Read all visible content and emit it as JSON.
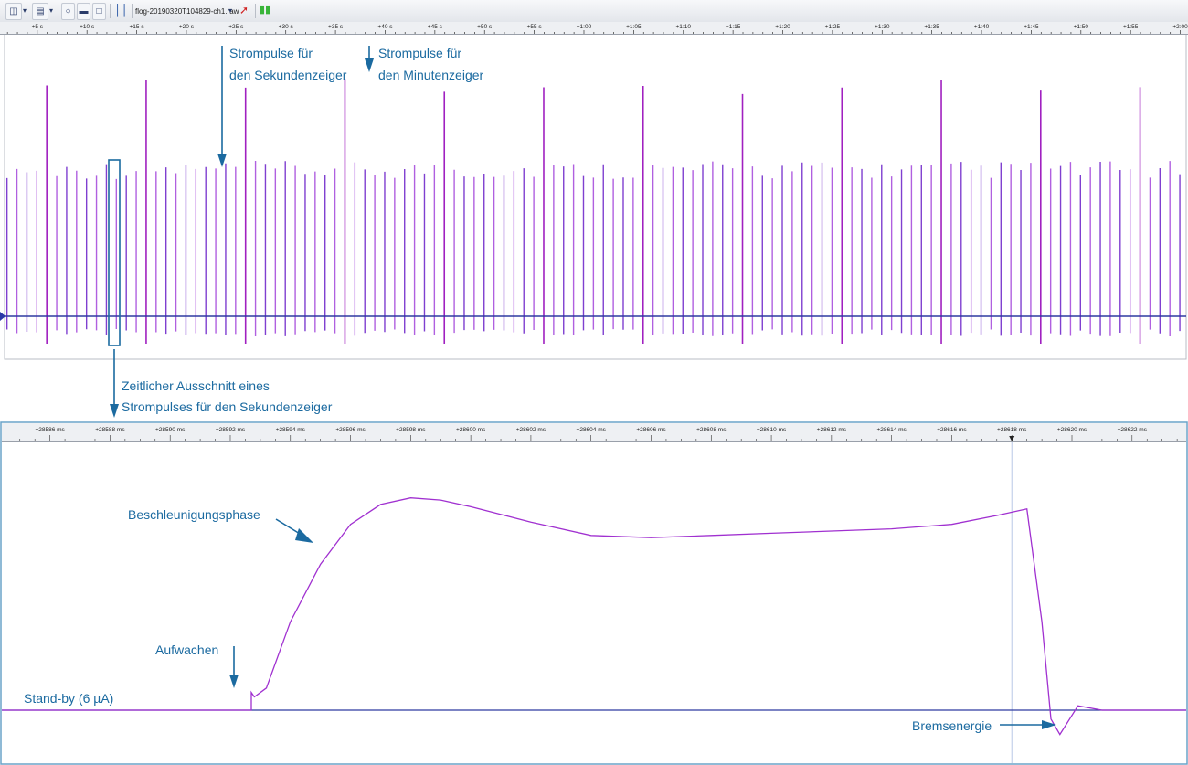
{
  "toolbar": {
    "file_name": "flog-20190320T104829-ch1.raw",
    "icons": [
      "open-folder-icon",
      "export-icon",
      "fit-icon",
      "zoom-out-icon",
      "zoom-reset-icon",
      "markers-icon",
      "dropdown-icon",
      "probe-icon",
      "battery-icon"
    ]
  },
  "colors": {
    "trace": "#a030d0",
    "annotation": "#1b6aa0",
    "axis": "#2e3aa0",
    "panel_border": "#6aa3c8"
  },
  "chart_data": [
    {
      "type": "line",
      "x_tick_labels": [
        "+5 s",
        "+10 s",
        "+15 s",
        "+20 s",
        "+25 s",
        "+30 s",
        "+35 s",
        "+40 s",
        "+45 s",
        "+50 s",
        "+55 s",
        "+1:00",
        "+1:05",
        "+1:10",
        "+1:15",
        "+1:20",
        "+1:25",
        "+1:30",
        "+1:35",
        "+1:40",
        "+1:45",
        "+1:50",
        "+1:55",
        "+2:00"
      ],
      "xlim_s": [
        1.8,
        120.5
      ],
      "x_unit": "s",
      "pulse_interval_s": 1,
      "first_pulse_s": 2,
      "minute_pulse_period_s": 10,
      "annotations": {
        "seconds_pulses": "Strompulse für\nden Sekundenzeiger",
        "minute_pulses": "Strompulse für\nden Minutenzeiger",
        "zoom_cutout": "Zeitlicher Ausschnitt eines\nStrompulses für den Sekundenzeiger"
      }
    },
    {
      "type": "line",
      "x_tick_labels": [
        "+28586 ms",
        "+28588 ms",
        "+28590 ms",
        "+28592 ms",
        "+28594 ms",
        "+28596 ms",
        "+28598 ms",
        "+28600 ms",
        "+28602 ms",
        "+28604 ms",
        "+28606 ms",
        "+28608 ms",
        "+28610 ms",
        "+28612 ms",
        "+28614 ms",
        "+28616 ms",
        "+28618 ms",
        "+28620 ms",
        "+28622 ms"
      ],
      "xlim_ms": [
        28584.4,
        28623.8
      ],
      "x_unit": "ms",
      "baseline": 0,
      "series": [
        {
          "x": [
            28592.7,
            28592.8,
            28593.2,
            28594.0,
            28595.0,
            28596.0,
            28597.0,
            28598.0,
            28599.0,
            28600.0,
            28602.0,
            28604.0,
            28606.0,
            28608.0,
            28610.0,
            28612.0,
            28614.0,
            28616.0,
            28617.5,
            28618.5,
            28619.0,
            28619.3,
            28619.6,
            28620.2,
            28621.0,
            28623.8
          ],
          "y": [
            0.08,
            0.06,
            0.1,
            0.4,
            0.66,
            0.84,
            0.93,
            0.96,
            0.95,
            0.92,
            0.85,
            0.79,
            0.78,
            0.79,
            0.8,
            0.81,
            0.82,
            0.84,
            0.88,
            0.91,
            0.4,
            -0.04,
            -0.11,
            0.02,
            0.0,
            0.0
          ]
        }
      ],
      "marker_ms": 28618.0,
      "annotations": {
        "acceleration": "Beschleunigungsphase",
        "wake_up": "Aufwachen",
        "standby": "Stand-by (6 µA)",
        "braking": "Bremsenergie"
      }
    }
  ]
}
